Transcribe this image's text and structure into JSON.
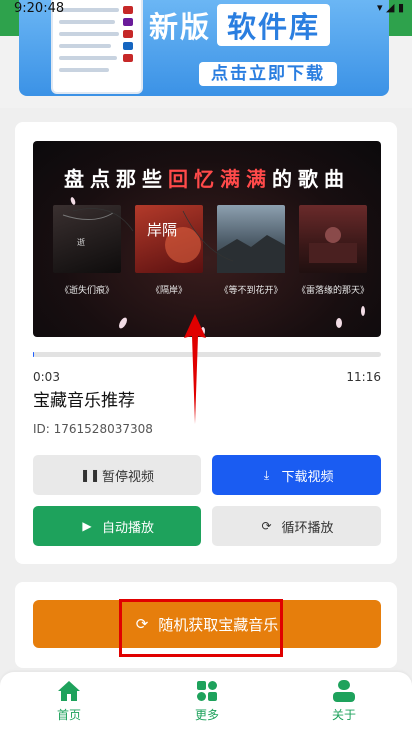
{
  "status": {
    "time": "9:20:48",
    "icons": "▾ ◢ ▮"
  },
  "banner": {
    "title_plain": "新版",
    "title_highlight": "软件库",
    "cta": "点击立即下载"
  },
  "video": {
    "overlay_title_a": "盘点那些",
    "overlay_title_red": "回忆满满",
    "overlay_title_b": "的歌曲",
    "albums": [
      {
        "caption": "《逝失们痕》"
      },
      {
        "caption": "《隔岸》"
      },
      {
        "caption": "《等不到花开》"
      },
      {
        "caption": "《雷落缘的那天》"
      }
    ],
    "album_cover_text_2": "岸隔",
    "progress": 0.004,
    "current_time": "0:03",
    "duration": "11:16",
    "title": "宝藏音乐推荐",
    "id_text": "ID: 1761528037308"
  },
  "buttons": {
    "pause": "暂停视频",
    "download": "下载视频",
    "autoplay": "自动播放",
    "loop": "循环播放",
    "random": "随机获取宝藏音乐"
  },
  "nav": {
    "items": [
      {
        "label": "首页"
      },
      {
        "label": "更多"
      },
      {
        "label": "关于"
      }
    ]
  },
  "colors": {
    "accent_green": "#1ea25c",
    "download_blue": "#1a5cf2",
    "random_orange": "#e67e0c",
    "highlight_red": "#e00000"
  }
}
